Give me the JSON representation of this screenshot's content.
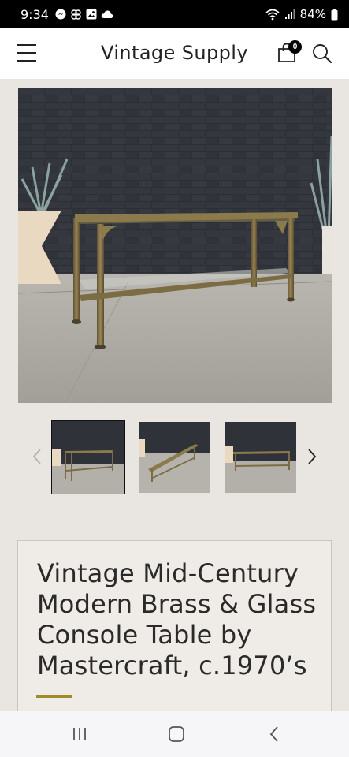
{
  "status_bar": {
    "time": "9:34",
    "battery": "84%",
    "left_icons": [
      "messenger-icon",
      "pinwheel-icon",
      "gallery-icon",
      "cloud-icon"
    ],
    "right_icons": [
      "wifi-icon",
      "signal-icon",
      "battery-icon"
    ]
  },
  "header": {
    "brand": "Vintage Supply",
    "cart_count": "0",
    "icons": [
      "menu-icon",
      "shopping-bag-icon",
      "search-icon"
    ]
  },
  "product": {
    "title": "Vintage Mid-Century Modern Brass & Glass Console Table by Mastercraft, c.1970’s",
    "accent_color": "#a28a2a"
  },
  "gallery": {
    "selected_index": 1,
    "thumbnail_count": 3,
    "icons": [
      "chevron-left-icon",
      "chevron-right-icon"
    ]
  },
  "nav_bar": {
    "icons": [
      "recent-apps-icon",
      "home-icon",
      "back-icon"
    ]
  }
}
